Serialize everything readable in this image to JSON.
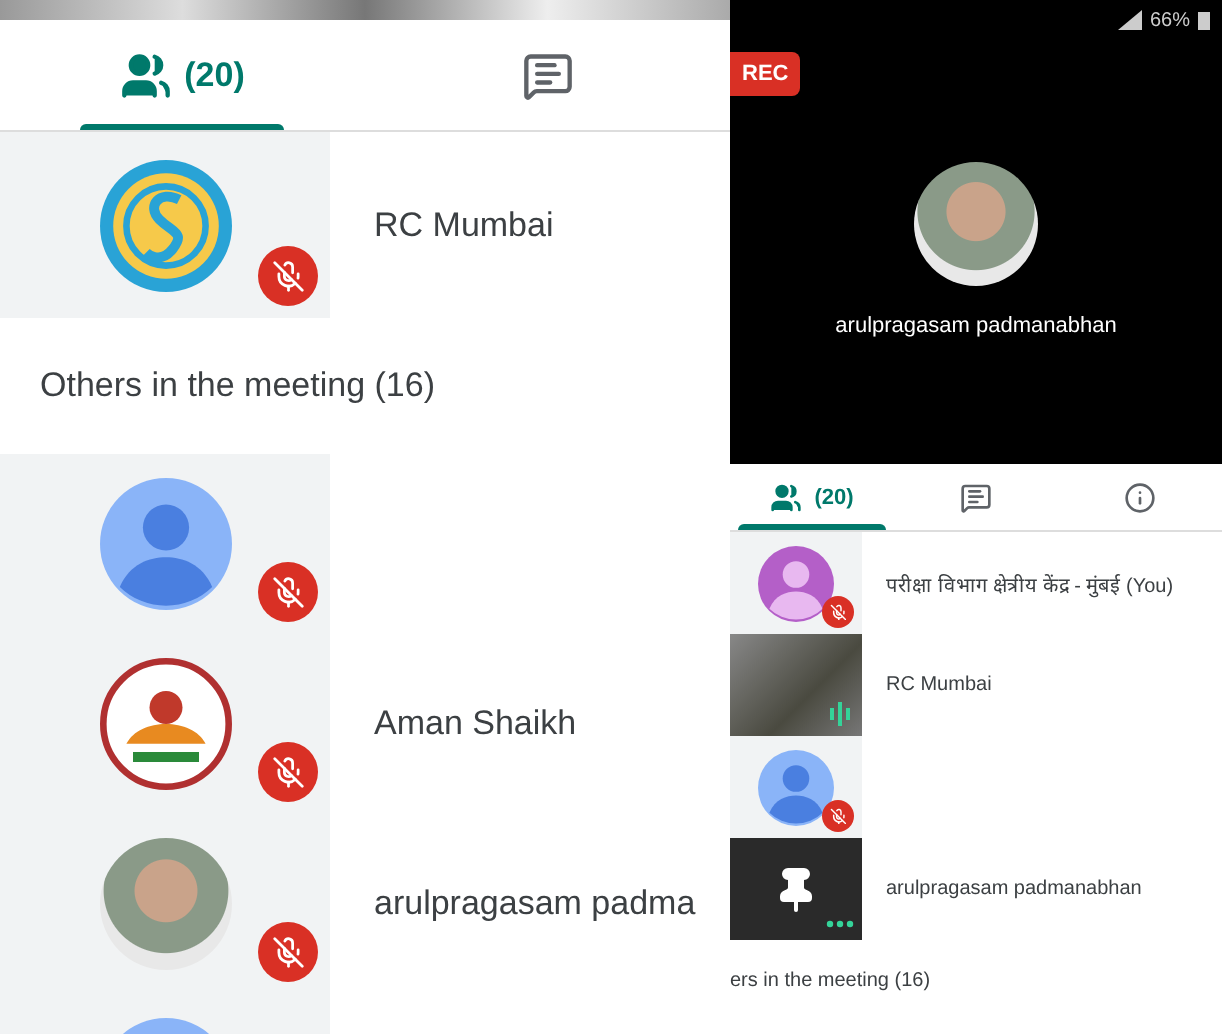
{
  "left": {
    "tabs": [
      {
        "kind": "people",
        "count": "(20)",
        "selected": true
      },
      {
        "kind": "chat",
        "selected": false
      }
    ],
    "pinned": [
      {
        "name": "RC Mumbai",
        "kind": "logo",
        "muted": true
      }
    ],
    "section": "Others in the meeting (16)",
    "participants": [
      {
        "kind": "default",
        "muted": true
      },
      {
        "name": "Aman Shaikh",
        "kind": "emblem",
        "muted": true
      },
      {
        "name": "arulpragasam padma",
        "kind": "photo",
        "muted": true
      },
      {
        "kind": "partial"
      }
    ]
  },
  "right": {
    "status_bar": {
      "battery": "66%"
    },
    "rec": "REC",
    "stage": {
      "name": "arulpragasam padmanabhan"
    },
    "tabs": [
      {
        "kind": "people",
        "count": "(20)",
        "selected": true
      },
      {
        "kind": "chat",
        "selected": false
      },
      {
        "kind": "info",
        "selected": false
      }
    ],
    "participants": [
      {
        "name": "परीक्षा विभाग क्षेत्रीय केंद्र - मुंबई (You)",
        "kind": "purple",
        "muted": true
      },
      {
        "name": "RC Mumbai",
        "kind": "video",
        "muted": false
      },
      {
        "kind": "default",
        "muted": true
      },
      {
        "name": "arulpragasam padmanabhan",
        "kind": "pin",
        "muted": false
      }
    ],
    "section": "ers in the meeting (16)"
  }
}
